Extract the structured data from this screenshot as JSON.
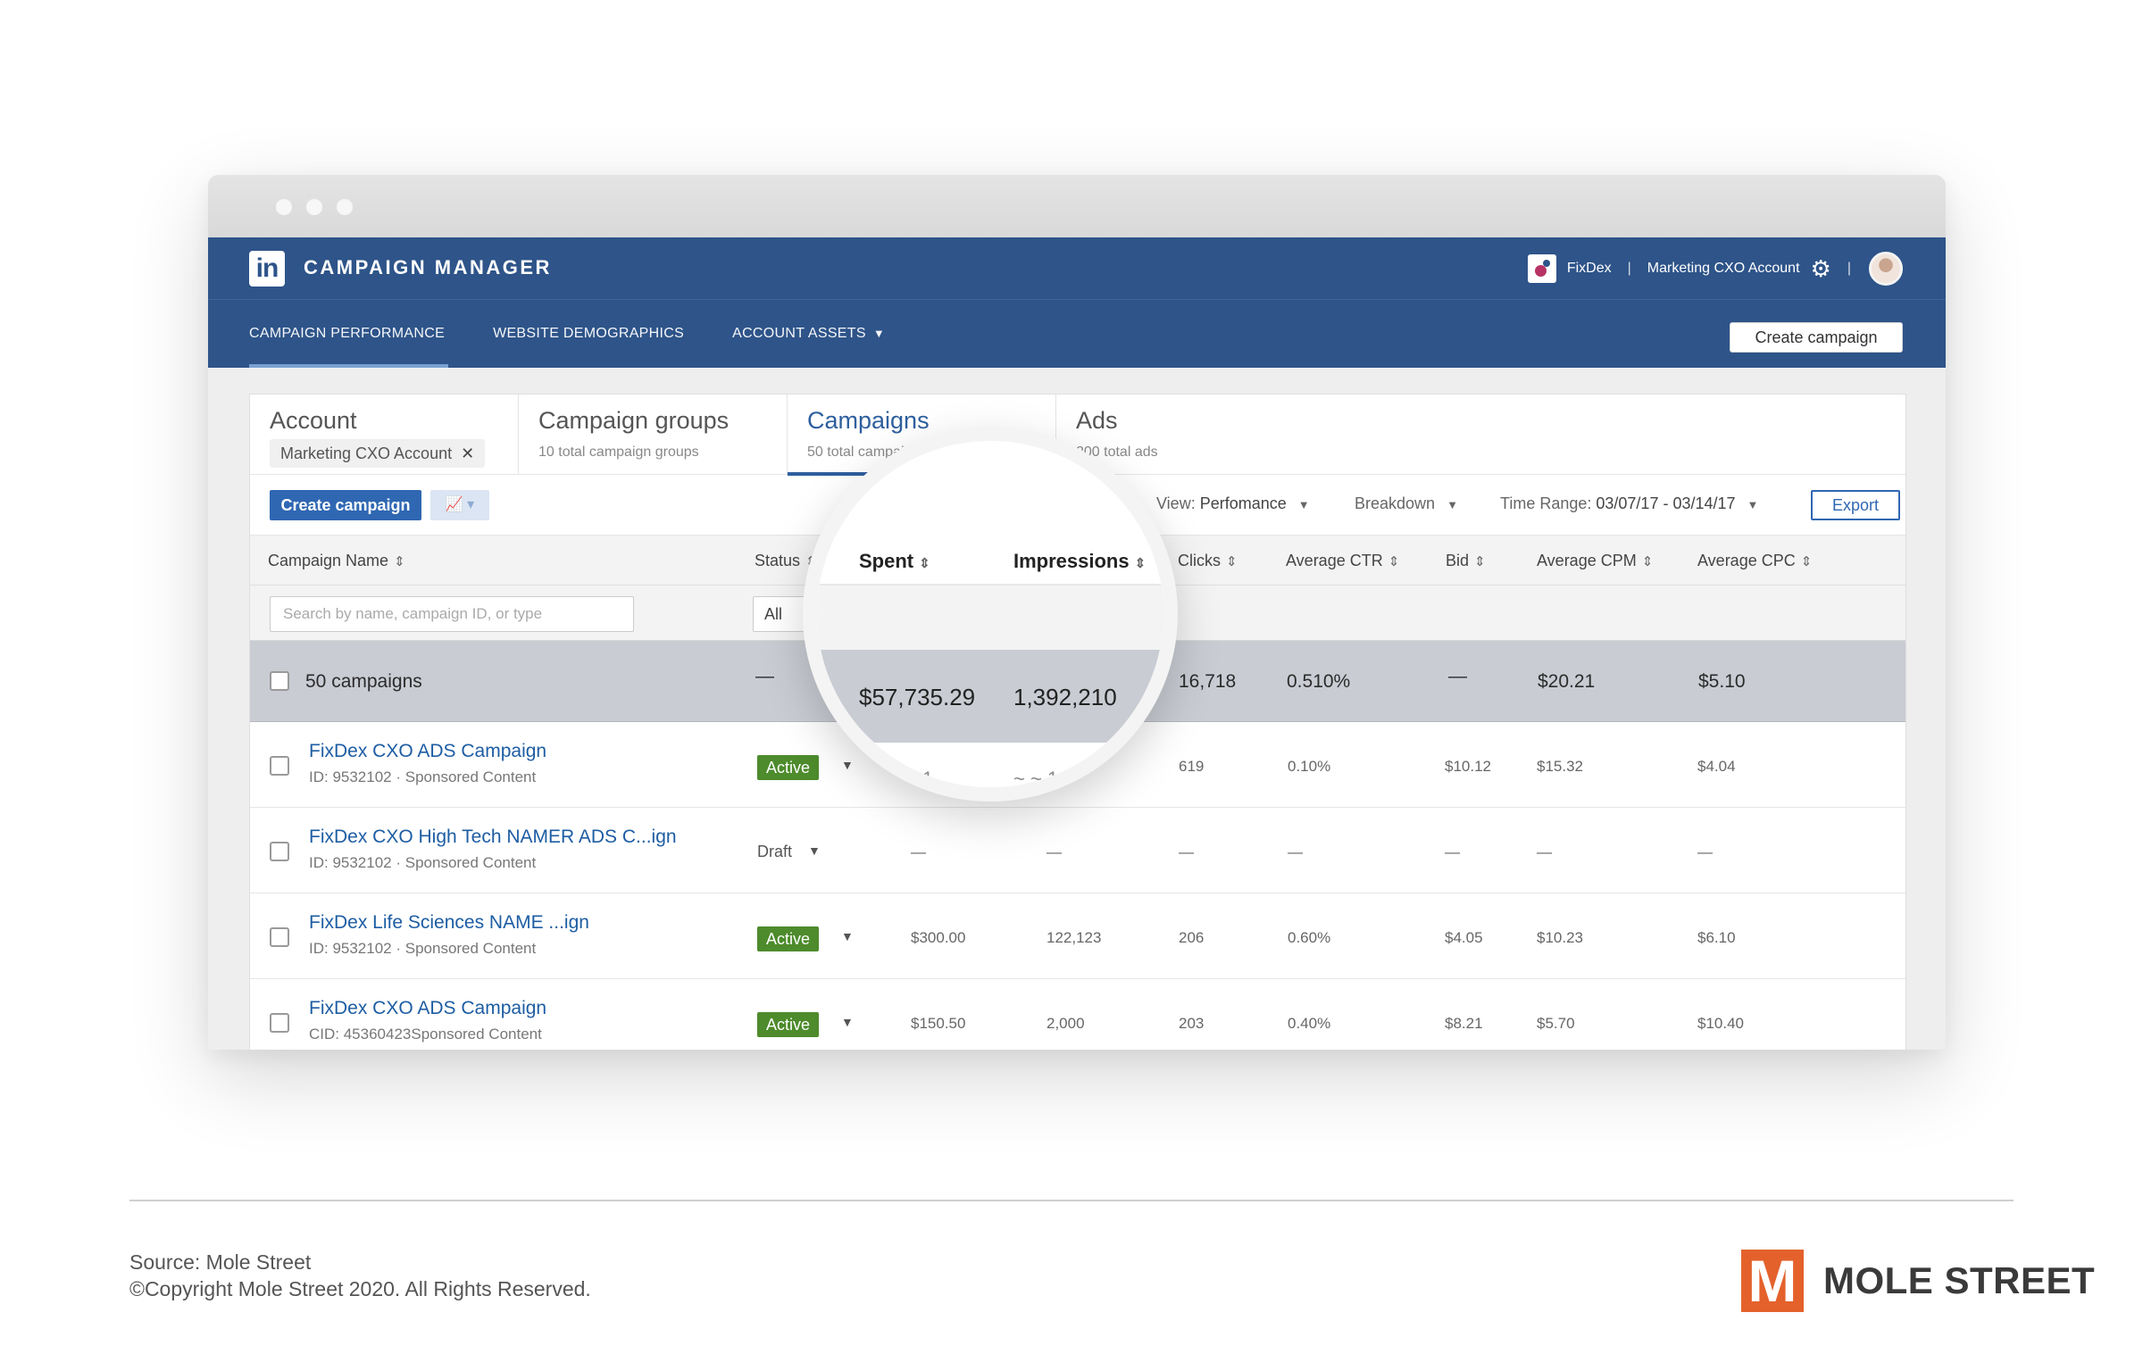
{
  "app": {
    "title": "CAMPAIGN MANAGER",
    "logo_text": "in",
    "company": "FixDex",
    "account": "Marketing CXO Account",
    "divider": "|"
  },
  "nav": {
    "items": [
      "CAMPAIGN PERFORMANCE",
      "WEBSITE DEMOGRAPHICS",
      "ACCOUNT ASSETS"
    ],
    "active": "CAMPAIGN PERFORMANCE",
    "create_label": "Create campaign"
  },
  "tabs": [
    {
      "title": "Account",
      "chip": "Marketing CXO Account"
    },
    {
      "title": "Campaign groups",
      "sub": "10 total campaign groups"
    },
    {
      "title": "Campaigns",
      "sub": "50 total campaigns"
    },
    {
      "title": "Ads",
      "sub": "200 total ads"
    }
  ],
  "toolbar": {
    "create_label": "Create campaign",
    "view_label": "View:",
    "view_value": "Perfomance",
    "breakdown": "Breakdown",
    "time_label": "Time Range:",
    "time_value": "03/07/17 - 03/14/17",
    "export": "Export"
  },
  "table": {
    "headers": {
      "name": "Campaign Name",
      "status": "Status",
      "spent": "Spent",
      "impressions": "Impressions",
      "clicks": "Clicks",
      "ctr": "Average CTR",
      "bid": "Bid",
      "cpm": "Average CPM",
      "cpc": "Average CPC"
    },
    "search_placeholder": "Search by name, campaign ID, or type",
    "status_filter": "All",
    "summary": {
      "label": "50 campaigns",
      "status": "—",
      "spent": "$57,735.29",
      "impressions": "1,392,210",
      "clicks": "16,718",
      "ctr": "0.510%",
      "bid": "—",
      "cpm": "$20.21",
      "cpc": "$5.10"
    },
    "rows": [
      {
        "name": "FixDex CXO ADS Campaign",
        "meta": "ID: 9532102  ·  Sponsored Content",
        "status": "Active",
        "spent": "",
        "impressions": "",
        "clicks": "619",
        "ctr": "0.10%",
        "bid": "$10.12",
        "cpm": "$15.32",
        "cpc": "$4.04"
      },
      {
        "name": "FixDex CXO High Tech NAMER ADS C...ign",
        "meta": "ID: 9532102  ·  Sponsored Content",
        "status": "Draft",
        "spent": "—",
        "impressions": "—",
        "clicks": "—",
        "ctr": "—",
        "bid": "—",
        "cpm": "—",
        "cpc": "—"
      },
      {
        "name": "FixDex Life Sciences NAME ...ign",
        "meta": "ID: 9532102  ·  Sponsored Content",
        "status": "Active",
        "spent": "$300.00",
        "impressions": "122,123",
        "clicks": "206",
        "ctr": "0.60%",
        "bid": "$4.05",
        "cpm": "$10.23",
        "cpc": "$6.10"
      },
      {
        "name": "FixDex CXO ADS Campaign",
        "meta": "CID: 45360423Sponsored Content",
        "status": "Active",
        "spent": "$150.50",
        "impressions": "2,000",
        "clicks": "203",
        "ctr": "0.40%",
        "bid": "$8.21",
        "cpm": "$5.70",
        "cpc": "$10.40"
      }
    ]
  },
  "magnifier": {
    "spent_header": "Spent",
    "impressions_header": "Impressions",
    "spent_value": "$57,735.29",
    "impressions_value": "1,392,210",
    "partial_1": "~ ~ 1",
    "partial_2": "~ ~ 1"
  },
  "footer": {
    "source": "Source: Mole Street",
    "copyright": "©Copyright Mole Street 2020. All Rights Reserved.",
    "brand": "MOLE STREET",
    "brand_mark": "M"
  },
  "colors": {
    "header_blue": "#2e5489",
    "link_blue": "#1d5da3",
    "active_green": "#4d8b2c",
    "brand_orange": "#e4612c"
  }
}
